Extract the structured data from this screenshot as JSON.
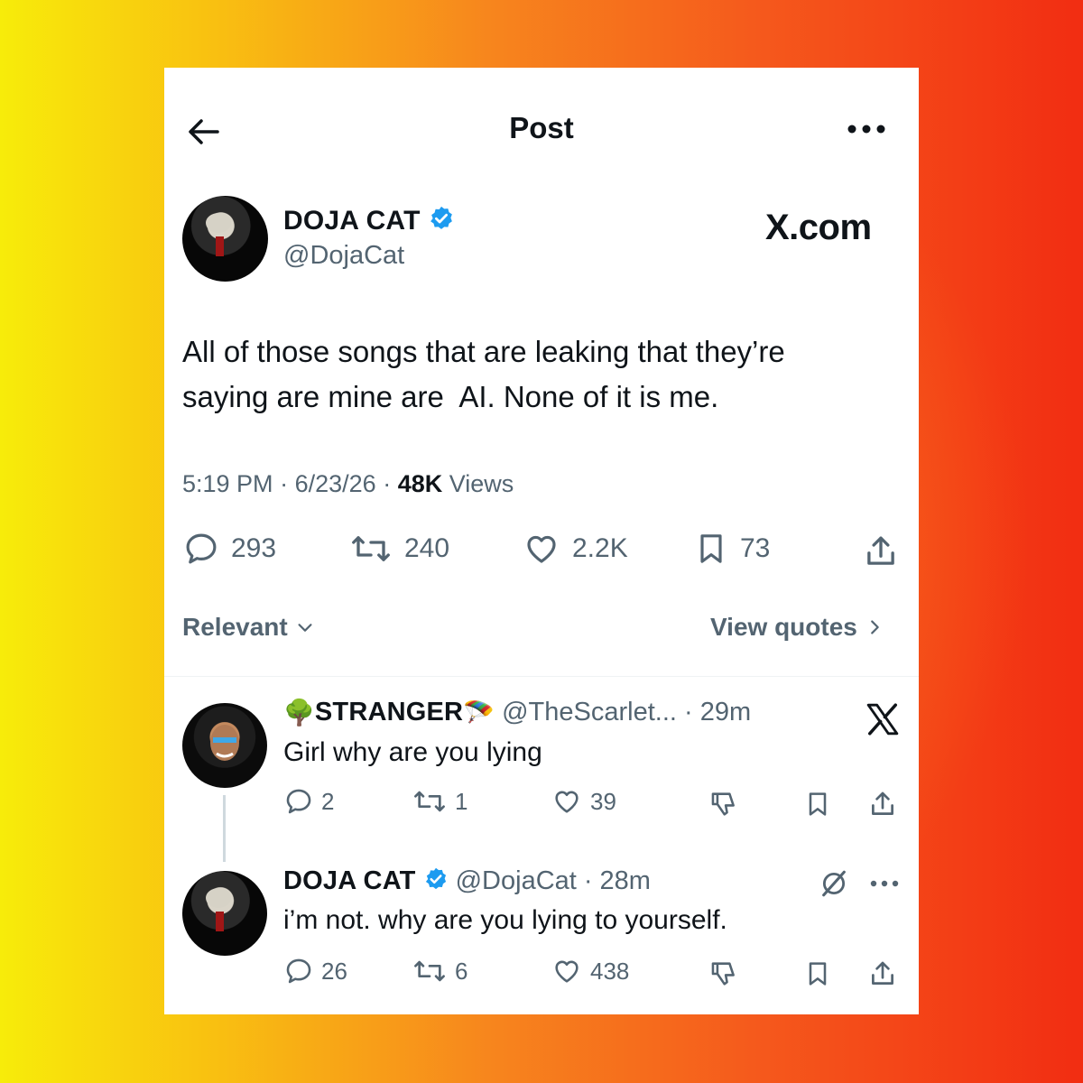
{
  "header": {
    "title": "Post"
  },
  "watermark": "X.com",
  "post": {
    "author": {
      "name": "DOJA CAT",
      "handle": "@DojaCat"
    },
    "text_line1": "All of those songs that are leaking that they’re",
    "text_line2": "saying are mine are  AI. None of it is me.",
    "time": "5:19 PM",
    "date": "6/23/26",
    "views_count": "48K",
    "views_label": "Views",
    "stats": {
      "replies": "293",
      "reposts": "240",
      "likes": "2.2K",
      "bookmarks": "73"
    }
  },
  "filters": {
    "sort_label": "Relevant",
    "quotes_label": "View quotes"
  },
  "replies": [
    {
      "name": "STRANGER",
      "handle": "@TheScarlet...",
      "time": "29m",
      "text": "Girl why are you lying",
      "stats": {
        "replies": "2",
        "reposts": "1",
        "likes": "39"
      }
    },
    {
      "name": "DOJA CAT",
      "handle": "@DojaCat",
      "time": "28m",
      "text": "i’m not. why are you lying to yourself.",
      "stats": {
        "replies": "26",
        "reposts": "6",
        "likes": "438"
      }
    }
  ],
  "colors": {
    "verified": "#1d9bf0",
    "secondary_text": "#536471",
    "primary_text": "#0f1419"
  }
}
